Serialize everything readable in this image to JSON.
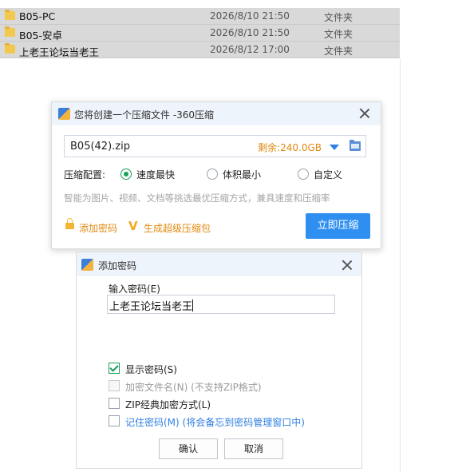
{
  "file_list": {
    "rows": [
      {
        "name": "B05-PC",
        "date": "2026/8/10 21:50",
        "type": "文件夹"
      },
      {
        "name": "B05-安卓",
        "date": "2026/8/10 21:50",
        "type": "文件夹"
      },
      {
        "name": "上老王论坛当老王",
        "date": "2026/8/12 17:00",
        "type": "文件夹"
      }
    ]
  },
  "compress_dialog": {
    "title": "您将创建一个压缩文件 -360压缩",
    "filename": "B05(42).zip",
    "space_left": "剩余:240.0GB",
    "config_label": "压缩配置:",
    "options": [
      {
        "label": "速度最快",
        "checked": true
      },
      {
        "label": "体积最小",
        "checked": false
      },
      {
        "label": "自定义",
        "checked": false
      }
    ],
    "hint": "智能为图片、视频、文档等挑选最优压缩方式，兼具速度和压缩率",
    "add_password_link": "添加密码",
    "super_compress_link": "生成超级压缩包",
    "compress_button": "立即压缩"
  },
  "password_dialog": {
    "title": "添加密码",
    "input_label": "输入密码(E)",
    "password_value": "上老王论坛当老王",
    "checkboxes": [
      {
        "label": "显示密码(S)",
        "note": "",
        "checked": true,
        "disabled": false,
        "style": "normal"
      },
      {
        "label": "加密文件名(N)",
        "note": "(不支持ZIP格式)",
        "checked": false,
        "disabled": true,
        "style": "dim"
      },
      {
        "label": "ZIP经典加密方式(L)",
        "note": "",
        "checked": false,
        "disabled": false,
        "style": "normal"
      },
      {
        "label": "记住密码(M)",
        "note": "(将会备忘到密码管理窗口中)",
        "checked": false,
        "disabled": false,
        "style": "blue"
      }
    ],
    "ok_button": "确认",
    "cancel_button": "取消"
  },
  "colors": {
    "accent_blue": "#2f8ff0",
    "orange_link": "#e08a10",
    "radio_green": "#1aa05a",
    "row_selected": "#d9d9d9"
  }
}
